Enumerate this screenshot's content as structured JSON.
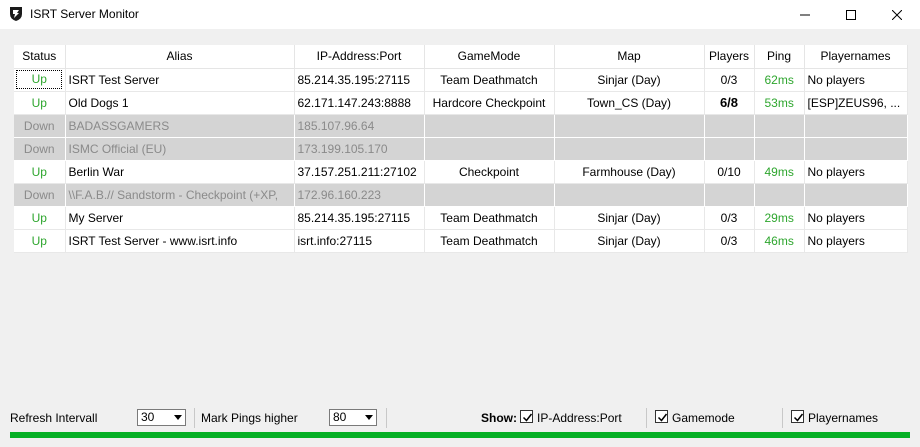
{
  "window": {
    "title": "ISRT Server Monitor"
  },
  "table": {
    "columns": [
      "Status",
      "Alias",
      "IP-Address:Port",
      "GameMode",
      "Map",
      "Players",
      "Ping",
      "Playernames"
    ],
    "rows": [
      {
        "status": "Up",
        "alias": "ISRT Test Server",
        "ip": "85.214.35.195:27115",
        "mode": "Team Deathmatch",
        "map": "Sinjar (Day)",
        "players": "0/3",
        "ping": "62ms",
        "names": "No players"
      },
      {
        "status": "Up",
        "alias": "Old Dogs 1",
        "ip": "62.171.147.243:8888",
        "mode": "Hardcore Checkpoint",
        "map": "Town_CS (Day)",
        "players": "6/8",
        "ping": "53ms",
        "names": "[ESP]ZEUS96, ..."
      },
      {
        "status": "Down",
        "alias": "BADASSGAMERS",
        "ip": "185.107.96.64",
        "mode": "",
        "map": "",
        "players": "",
        "ping": "",
        "names": ""
      },
      {
        "status": "Down",
        "alias": "ISMC Official (EU)",
        "ip": "173.199.105.170",
        "mode": "",
        "map": "",
        "players": "",
        "ping": "",
        "names": ""
      },
      {
        "status": "Up",
        "alias": "Berlin War",
        "ip": "37.157.251.211:27102",
        "mode": "Checkpoint",
        "map": "Farmhouse (Day)",
        "players": "0/10",
        "ping": "49ms",
        "names": "No players"
      },
      {
        "status": "Down",
        "alias": "\\\\F.A.B.// Sandstorm - Checkpoint (+XP,",
        "ip": "172.96.160.223",
        "mode": "",
        "map": "",
        "players": "",
        "ping": "",
        "names": ""
      },
      {
        "status": "Up",
        "alias": "My Server",
        "ip": "85.214.35.195:27115",
        "mode": "Team Deathmatch",
        "map": "Sinjar (Day)",
        "players": "0/3",
        "ping": "29ms",
        "names": "No players"
      },
      {
        "status": "Up",
        "alias": "ISRT Test Server - www.isrt.info",
        "ip": "isrt.info:27115",
        "mode": "Team Deathmatch",
        "map": "Sinjar (Day)",
        "players": "0/3",
        "ping": "46ms",
        "names": "No players"
      }
    ]
  },
  "bottom": {
    "refresh_label": "Refresh Intervall",
    "refresh_value": "30",
    "mark_label": "Mark Pings higher",
    "mark_value": "80",
    "show_label": "Show:",
    "show_ip_label": "IP-Address:Port",
    "show_mode_label": "Gamemode",
    "show_names_label": "Playernames"
  },
  "progress": {
    "fraction": 1.0
  },
  "colors": {
    "up": "#2ea62e",
    "down_row": "#d4d4d4",
    "progress": "#06b025"
  }
}
